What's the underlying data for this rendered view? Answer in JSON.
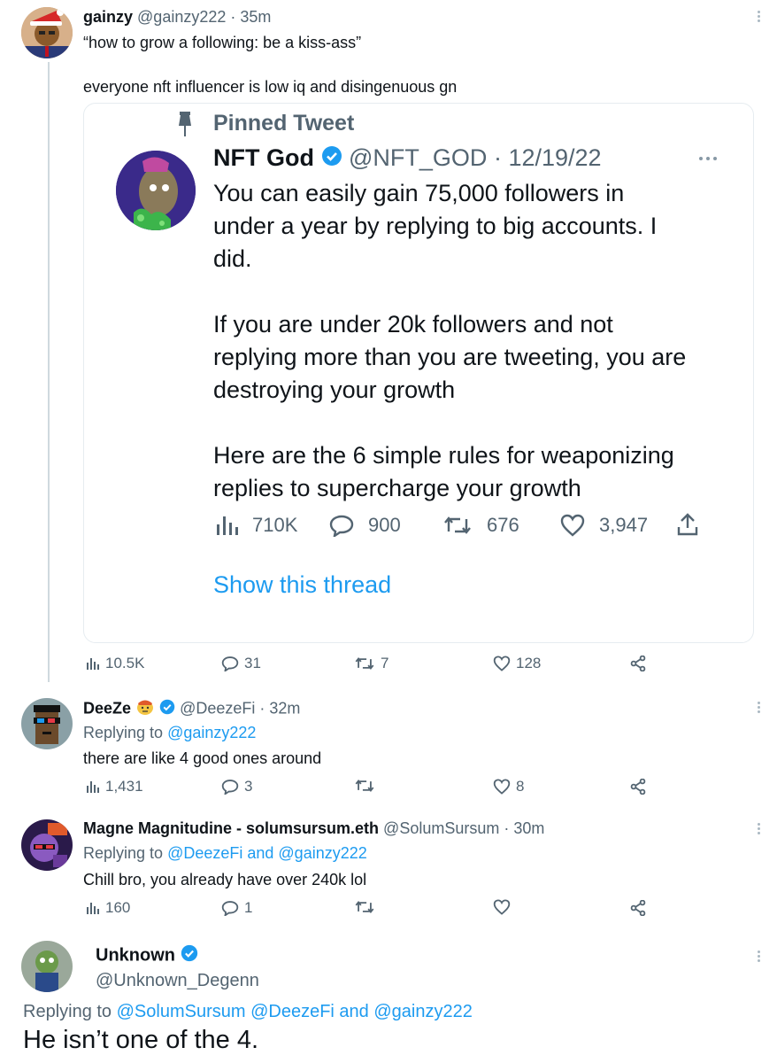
{
  "tweet1": {
    "author_name": "gainzy",
    "handle": "@gainzy222",
    "time": "· 35m",
    "quote_line": "“how to grow a following: be a kiss-ass”",
    "body_line": "everyone nft influencer is low iq and disingenuous gn",
    "stats": {
      "views": "10.5K",
      "replies": "31",
      "retweets": "7",
      "likes": "128"
    }
  },
  "embedded": {
    "pinned_label": "Pinned Tweet",
    "author_name": "NFT God",
    "handle": "@NFT_GOD",
    "date": "· 12/19/22",
    "para1_line1": "You can easily gain 75,000 followers in",
    "para1_line2": "under a year by replying to big accounts. I",
    "para1_line3": "did.",
    "para2_line1": "If you are under 20k followers and not",
    "para2_line2": "replying more than you are tweeting, you are",
    "para2_line3": "destroying your growth",
    "para3_line1": "Here are the 6 simple rules for weaponizing",
    "para3_line2": "replies to supercharge your growth",
    "stats": {
      "views": "710K",
      "replies": "900",
      "retweets": "676",
      "likes": "3,947"
    },
    "show_thread": "Show this thread"
  },
  "reply1": {
    "author_name": "DeeZe",
    "handle": "@DeezeFi",
    "time": "· 32m",
    "replying_prefix": "Replying to",
    "replying_to": "@gainzy222",
    "body": "there are like 4 good ones around",
    "stats": {
      "views": "1,431",
      "replies": "3",
      "retweets": "",
      "likes": "8"
    }
  },
  "reply2": {
    "author_name": "Magne Magnitudine - solumsursum.eth",
    "handle": "@SolumSursum",
    "time": "· 30m",
    "replying_prefix": "Replying to",
    "replying_to": "@DeezeFi and @gainzy222",
    "body": "Chill bro, you already have over 240k lol",
    "stats": {
      "views": "160",
      "replies": "1",
      "retweets": "",
      "likes": ""
    }
  },
  "reply3": {
    "author_name": "Unknown",
    "handle": "@Unknown_Degenn",
    "replying_prefix": "Replying to",
    "replying_to": "@SolumSursum @DeezeFi and @gainzy222",
    "body": "He isn’t one of the 4."
  },
  "colors": {
    "accent": "#1d9bf0",
    "muted": "#536471",
    "text": "#0f1419",
    "border": "#cfd9de"
  }
}
